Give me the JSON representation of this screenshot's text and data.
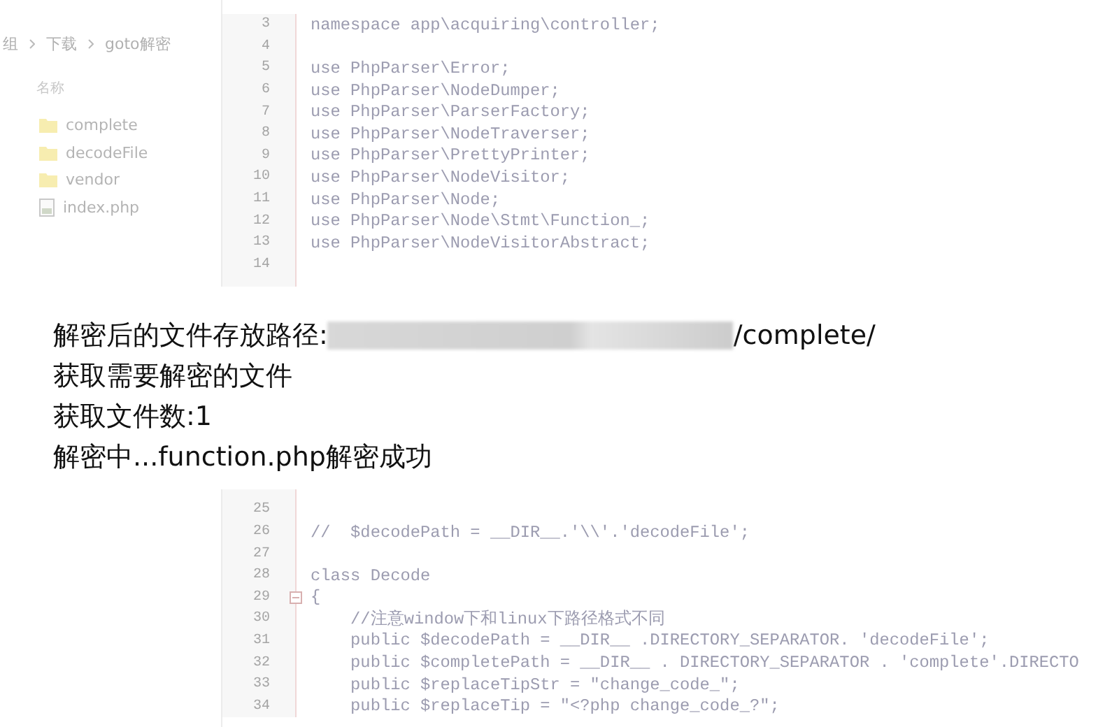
{
  "explorer": {
    "breadcrumb": [
      "组",
      "下载",
      "goto解密"
    ],
    "column_header": "名称",
    "items": [
      {
        "name": "complete",
        "kind": "folder"
      },
      {
        "name": "decodeFile",
        "kind": "folder"
      },
      {
        "name": "vendor",
        "kind": "folder"
      },
      {
        "name": "index.php",
        "kind": "file"
      }
    ]
  },
  "editor": {
    "top_lines": [
      {
        "number": "3",
        "code": "namespace app\\acquiring\\controller;"
      },
      {
        "number": "4"
      },
      {
        "number": "5",
        "code": "use PhpParser\\Error;"
      },
      {
        "number": "6",
        "code": "use PhpParser\\NodeDumper;"
      },
      {
        "number": "7",
        "code": "use PhpParser\\ParserFactory;"
      },
      {
        "number": "8",
        "code": "use PhpParser\\NodeTraverser;"
      },
      {
        "number": "9",
        "code": "use PhpParser\\PrettyPrinter;"
      },
      {
        "number": "10",
        "code": "use PhpParser\\NodeVisitor;"
      },
      {
        "number": "11",
        "code": "use PhpParser\\Node;"
      },
      {
        "number": "12",
        "code": "use PhpParser\\Node\\Stmt\\Function_;"
      },
      {
        "number": "13",
        "code": "use PhpParser\\NodeVisitorAbstract;"
      },
      {
        "number": "14"
      }
    ],
    "bottom_lines": [
      {
        "number": "25"
      },
      {
        "number": "26",
        "code": "//  $decodePath = __DIR__.'\\\\'.'decodeFile';"
      },
      {
        "number": "27"
      },
      {
        "number": "28",
        "code": "class Decode"
      },
      {
        "number": "29",
        "code": "{",
        "expanded": true
      },
      {
        "number": "30",
        "code": "    //注意window下和linux下路径格式不同"
      },
      {
        "number": "31",
        "code": "    public $decodePath = __DIR__ .DIRECTORY_SEPARATOR. 'decodeFile';"
      },
      {
        "number": "32",
        "code": "    public $completePath = __DIR__ . DIRECTORY_SEPARATOR . 'complete'.DIRECTO"
      },
      {
        "number": "33",
        "code": "    public $replaceTipStr = \"change_code_\";"
      },
      {
        "number": "34",
        "code": "    public $replaceTip = \"<?php change_code_?\";"
      }
    ]
  },
  "console": {
    "lines": [
      {
        "kind": "path",
        "prefix": "解密后的文件存放路径:",
        "suffix": "/complete/"
      },
      {
        "kind": "text",
        "text": "获取需要解密的文件"
      },
      {
        "kind": "text",
        "text": "获取文件数:1"
      },
      {
        "kind": "text",
        "text": "解密中...function.php解密成功"
      }
    ]
  }
}
